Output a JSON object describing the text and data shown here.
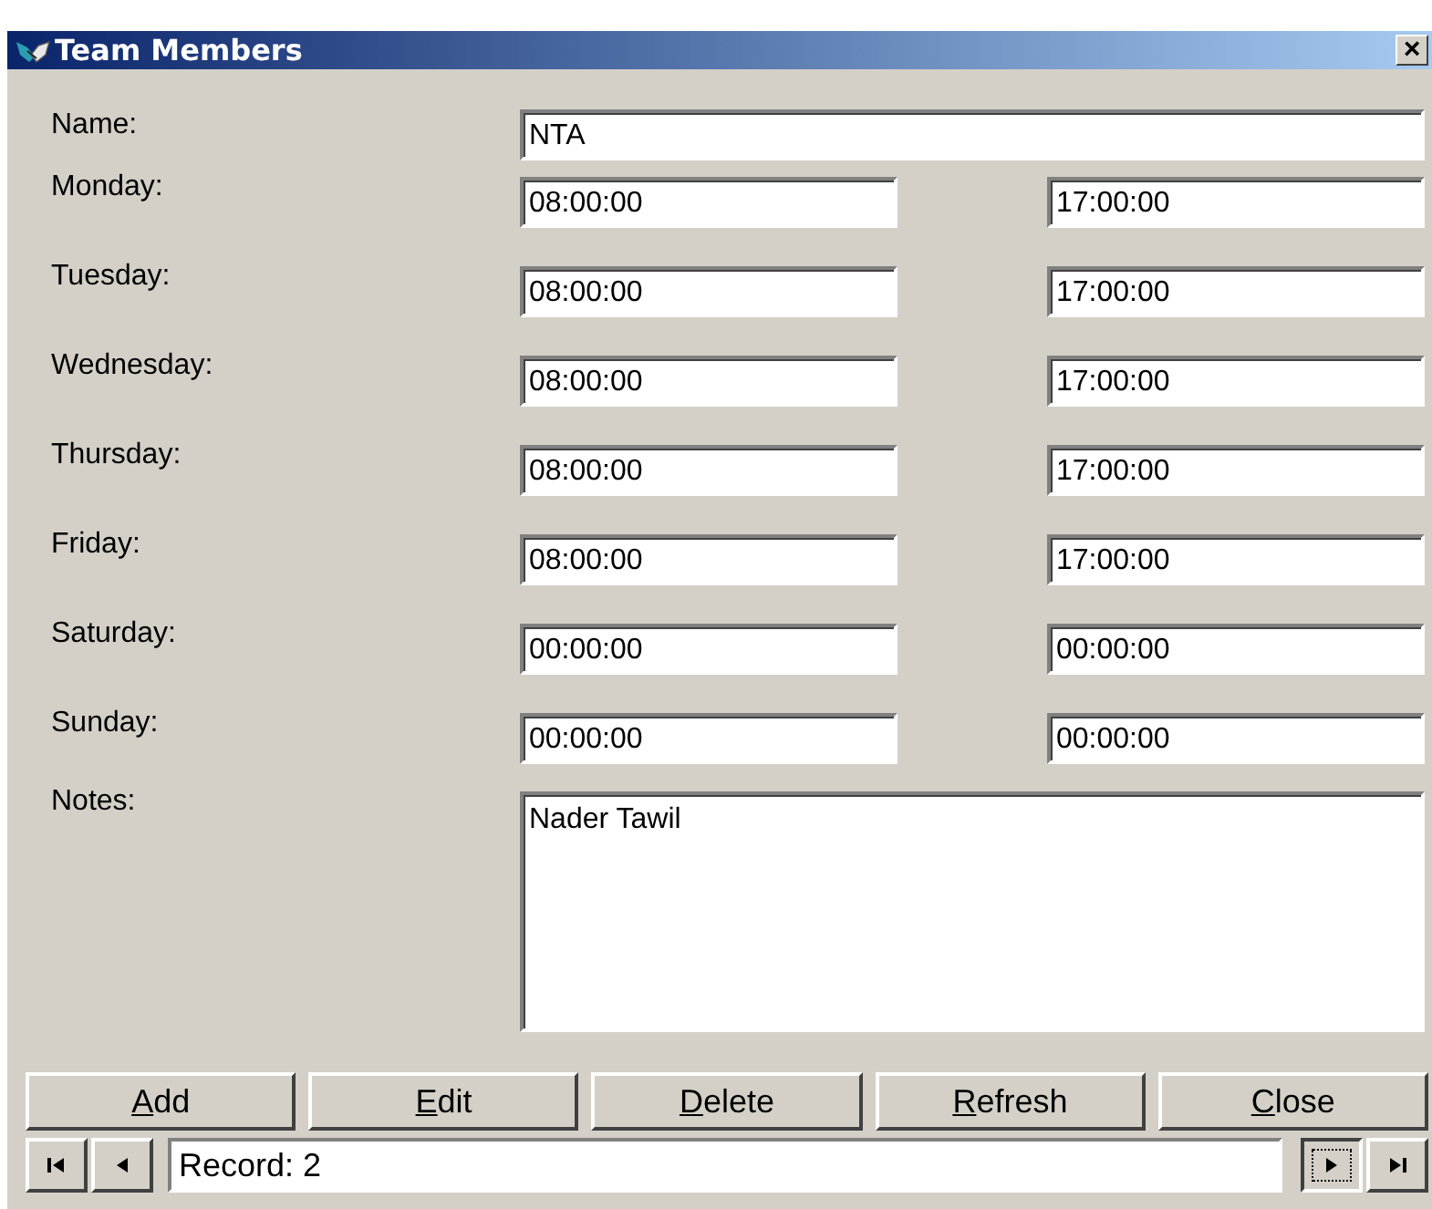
{
  "window": {
    "title": "Team Members",
    "close": "×"
  },
  "name": {
    "label": "Name:",
    "value": "NTA"
  },
  "days": [
    {
      "label": "Monday:",
      "start": "08:00:00",
      "end": "17:00:00"
    },
    {
      "label": "Tuesday:",
      "start": "08:00:00",
      "end": "17:00:00"
    },
    {
      "label": "Wednesday:",
      "start": "08:00:00",
      "end": "17:00:00"
    },
    {
      "label": "Thursday:",
      "start": "08:00:00",
      "end": "17:00:00"
    },
    {
      "label": "Friday:",
      "start": "08:00:00",
      "end": "17:00:00"
    },
    {
      "label": "Saturday:",
      "start": "00:00:00",
      "end": "00:00:00"
    },
    {
      "label": "Sunday:",
      "start": "00:00:00",
      "end": "00:00:00"
    }
  ],
  "notes": {
    "label": "Notes:",
    "value": "Nader Tawil"
  },
  "buttons": [
    {
      "access_key": "A",
      "rest": "dd"
    },
    {
      "access_key": "E",
      "rest": "dit"
    },
    {
      "access_key": "D",
      "rest": "elete"
    },
    {
      "access_key": "R",
      "rest": "efresh"
    },
    {
      "access_key": "C",
      "rest": "lose"
    }
  ],
  "navigator": {
    "record": "Record: 2"
  }
}
